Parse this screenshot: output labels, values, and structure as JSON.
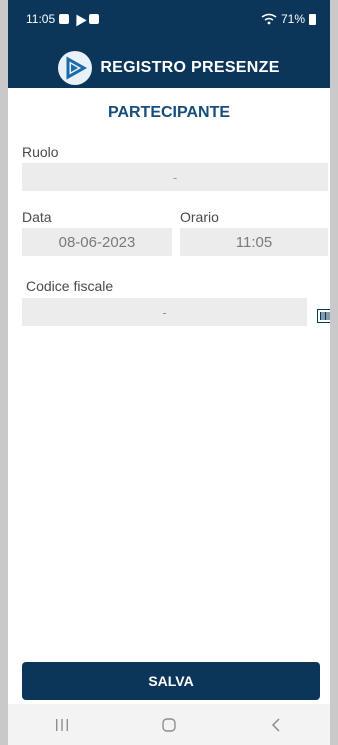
{
  "status_bar": {
    "time": "11:05",
    "battery": "71%"
  },
  "header": {
    "app_title": "REGISTRO PRESENZE"
  },
  "page": {
    "title": "PARTECIPANTE"
  },
  "form": {
    "ruolo": {
      "label": "Ruolo",
      "value": "-"
    },
    "data": {
      "label": "Data",
      "value": "08-06-2023"
    },
    "orario": {
      "label": "Orario",
      "value": "11:05"
    },
    "codice_fiscale": {
      "label": "Codice fiscale",
      "value": "-"
    }
  },
  "actions": {
    "save_label": "SALVA"
  },
  "colors": {
    "primary": "#0c3659",
    "title": "#164d7c",
    "field_bg": "#ececec"
  },
  "icons": {
    "scan": "barcode-scan-icon",
    "recent_apps": "recent-apps-icon",
    "home": "home-icon",
    "back": "back-icon"
  }
}
